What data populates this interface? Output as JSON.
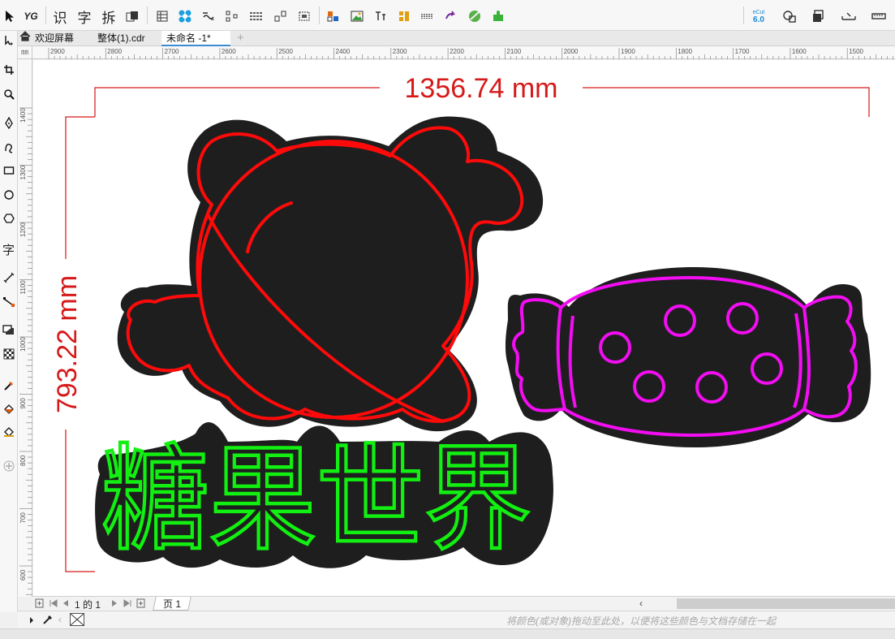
{
  "toolbar": {
    "yg_label": "YG",
    "shi": "识",
    "zi": "字",
    "chai": "拆",
    "ecut_label": "eCut",
    "ecut_version": "6.0"
  },
  "doc_tabs": [
    {
      "label": "欢迎屏幕"
    },
    {
      "label": "整体(1).cdr"
    },
    {
      "label": "未命名 -1*"
    }
  ],
  "toolbox": {
    "text_tool": "字"
  },
  "rulers": {
    "corner_unit": "㎜",
    "h_ticks": [
      "2900",
      "2800",
      "2700",
      "2600",
      "2500",
      "2400",
      "2300",
      "2200",
      "2100",
      "2000",
      "1900",
      "1800",
      "1700",
      "1600",
      "1500"
    ],
    "v_ticks": [
      "1400",
      "1300",
      "1200",
      "1100",
      "1000",
      "900",
      "800",
      "700",
      "600"
    ]
  },
  "canvas": {
    "width_dimension": "1356.74 mm",
    "height_dimension": "793.22 mm",
    "title_text": "糖果世界",
    "colors": {
      "backing": "#1e1e1e",
      "candy1": "#ff0a0a",
      "candy2": "#f20df2",
      "text": "#12f012",
      "dimension": "#d61919"
    }
  },
  "page_nav": {
    "counter": "1 的 1",
    "page_tab": "页 1"
  },
  "statusbar": {
    "hint": "将颜色(或对象)拖动至此处，以便将这些颜色与文档存储在一起"
  }
}
